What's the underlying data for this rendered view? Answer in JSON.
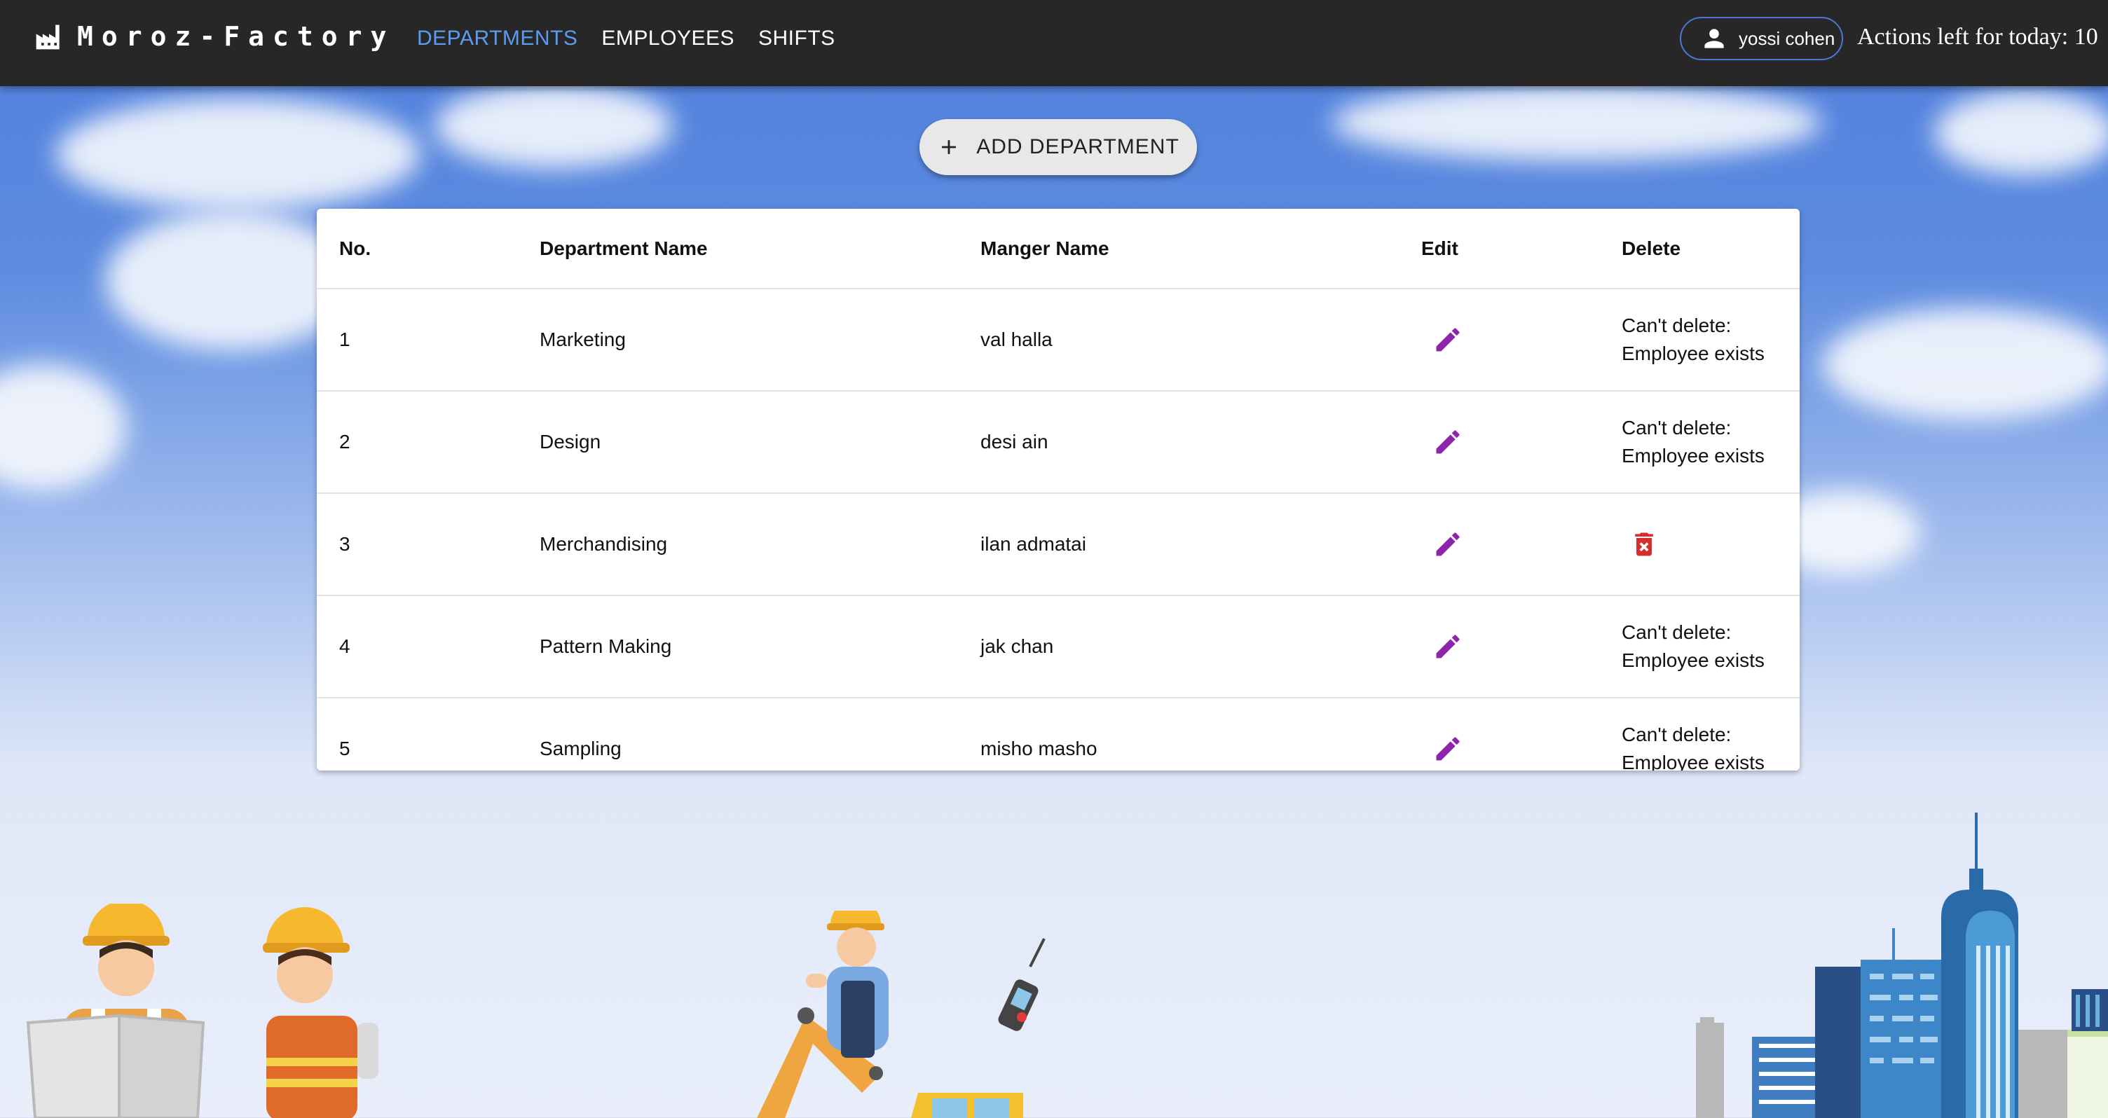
{
  "app": {
    "brand": "Moroz-Factory",
    "nav": [
      {
        "label": "DEPARTMENTS",
        "active": true
      },
      {
        "label": "EMPLOYEES",
        "active": false
      },
      {
        "label": "SHIFTS",
        "active": false
      }
    ],
    "user_name": "yossi cohen",
    "actions_left": "Actions left for today: 10"
  },
  "toolbar": {
    "add_label": "ADD DEPARTMENT"
  },
  "table": {
    "headers": [
      "No.",
      "Department Name",
      "Manger Name",
      "Edit",
      "Delete"
    ],
    "rows": [
      {
        "no": "1",
        "name": "Marketing",
        "manager": "val halla",
        "delete_text_1": "Can't delete:",
        "delete_text_2": "Employee exists",
        "deletable": false
      },
      {
        "no": "2",
        "name": "Design",
        "manager": "desi ain",
        "delete_text_1": "Can't delete:",
        "delete_text_2": "Employee exists",
        "deletable": false
      },
      {
        "no": "3",
        "name": "Merchandising",
        "manager": "ilan admatai",
        "delete_text_1": "",
        "delete_text_2": "",
        "deletable": true
      },
      {
        "no": "4",
        "name": "Pattern Making",
        "manager": "jak chan",
        "delete_text_1": "Can't delete:",
        "delete_text_2": "Employee exists",
        "deletable": false
      },
      {
        "no": "5",
        "name": "Sampling",
        "manager": "misho masho",
        "delete_text_1": "Can't delete:",
        "delete_text_2": "Employee exists",
        "deletable": false
      }
    ]
  },
  "colors": {
    "topbar": "#272727",
    "active_nav": "#5b9cf0",
    "edit_icon": "#8e24aa",
    "delete_icon": "#d32f2f"
  },
  "icons": {
    "brand": "factory-icon",
    "user": "person-icon",
    "add": "plus-icon",
    "edit": "pencil-icon",
    "delete": "trash-icon"
  }
}
